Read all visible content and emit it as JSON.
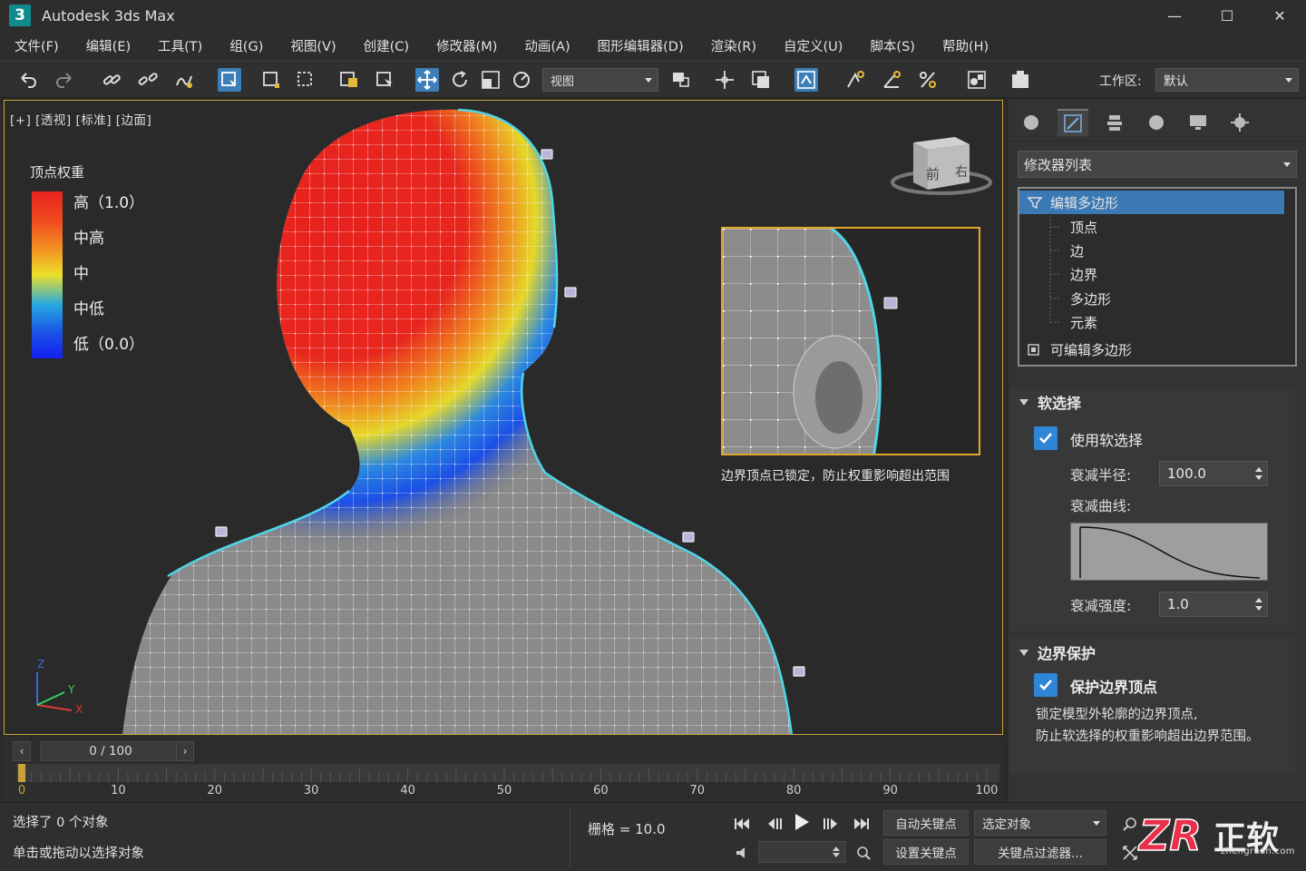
{
  "app": {
    "title": "Autodesk 3ds Max",
    "logo": "3"
  },
  "window": {
    "minimize": "—",
    "maximize": "☐",
    "close": "✕"
  },
  "menu": [
    "文件(F)",
    "编辑(E)",
    "工具(T)",
    "组(G)",
    "视图(V)",
    "创建(C)",
    "修改器(M)",
    "动画(A)",
    "图形编辑器(D)",
    "渲染(R)",
    "自定义(U)",
    "脚本(S)",
    "帮助(H)"
  ],
  "toolbar": {
    "view_dropdown": "视图",
    "workspace_label": "工作区:",
    "workspace_value": "默认",
    "icons": [
      "undo-icon",
      "redo-icon",
      "link-icon",
      "unlink-icon",
      "bind-spacewarp-icon",
      "select-object-icon",
      "select-region-icon",
      "window-crossing-icon",
      "select-by-name-icon",
      "select-and-manipulate-icon",
      "move-icon",
      "rotate-icon",
      "scale-icon",
      "rotate-scale-icon",
      "use-pivot-icon",
      "select-and-link-icon",
      "mirror-icon",
      "align-icon",
      "snap-toggle-icon",
      "angle-snap-icon",
      "percent-snap-icon",
      "spinner-snap-icon",
      "named-selection-icon",
      "render-setup-icon"
    ]
  },
  "viewport": {
    "label": "[+] [透视] [标准] [边面]",
    "legend": {
      "title": "顶点权重",
      "labels": [
        "高（1.0）",
        "中高",
        "中",
        "中低",
        "低（0.0）"
      ],
      "colors": [
        "#e8221e",
        "#f3a223",
        "#ece12a",
        "#27a7e0",
        "#1420f0"
      ]
    },
    "inset_caption": "边界顶点已锁定，防止权重影响超出范围",
    "viewcube": {
      "front": "前",
      "right": "右"
    },
    "axes": {
      "x": "X",
      "y": "Y",
      "z": "Z"
    },
    "boundary_color": "#4fd6e8"
  },
  "command_panel": {
    "modifier_list": "修改器列表",
    "stack": {
      "selected": "编辑多边形",
      "subobjects": [
        "顶点",
        "边",
        "边界",
        "多边形",
        "元素"
      ],
      "base": "可编辑多边形"
    },
    "soft_selection": {
      "title": "软选择",
      "use_label": "使用软选择",
      "use_checked": true,
      "falloff_label": "衰减半径:",
      "falloff_value": "100.0",
      "curve_label": "衰减曲线:",
      "strength_label": "衰减强度:",
      "strength_value": "1.0"
    },
    "boundary_protect": {
      "title": "边界保护",
      "protect_label": "保护边界顶点",
      "protect_checked": true,
      "desc_line1": "锁定模型外轮廓的边界顶点,",
      "desc_line2": "防止软选择的权重影响超出边界范围。"
    }
  },
  "timeline": {
    "frame_display": "0 / 100",
    "prev": "‹",
    "next": "›",
    "ticks": [
      "0",
      "10",
      "20",
      "30",
      "40",
      "50",
      "60",
      "70",
      "80",
      "90",
      "100"
    ]
  },
  "status": {
    "selection": "选择了 0 个对象",
    "hint": "单击或拖动以选择对象",
    "grid": "栅格 = 10.0",
    "auto_key": "自动关键点",
    "selected_object": "选定对象",
    "set_key": "设置关键点",
    "key_filters": "关键点过滤器..."
  },
  "watermark": {
    "text": "正软",
    "sub": "zhengruan.com"
  }
}
